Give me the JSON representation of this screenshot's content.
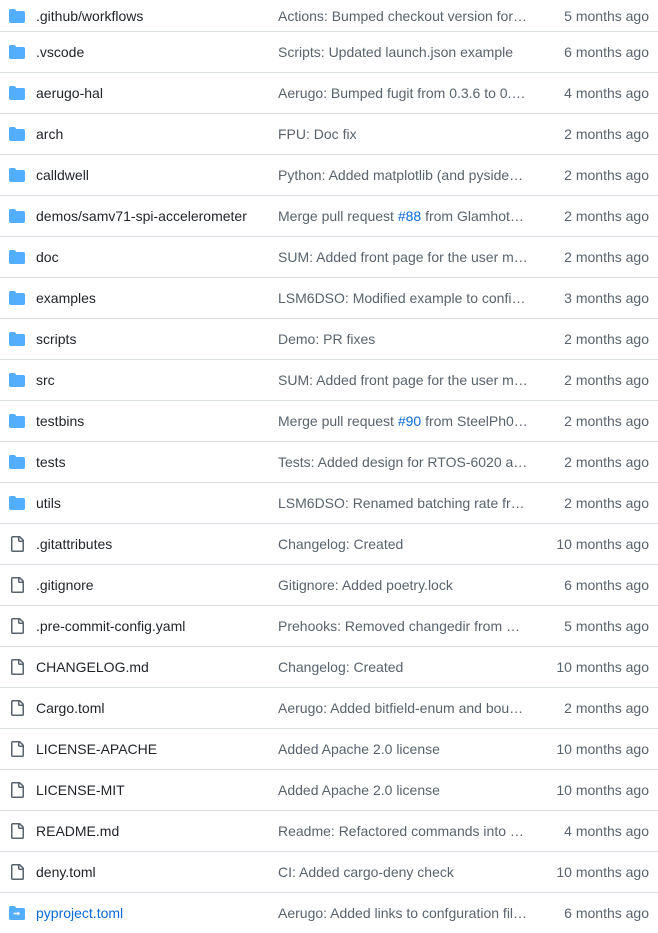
{
  "colors": {
    "folder": "#54aeff",
    "file": "#59636e",
    "link": "#0969da",
    "border": "#d8dee4"
  },
  "rows": [
    {
      "type": "dir",
      "name": ".github/workflows",
      "message": "Actions: Bumped checkout version for …",
      "age": "5 months ago"
    },
    {
      "type": "dir",
      "name": ".vscode",
      "message": "Scripts: Updated launch.json example",
      "age": "6 months ago"
    },
    {
      "type": "dir",
      "name": "aerugo-hal",
      "message": "Aerugo: Bumped fugit from 0.3.6 to 0.…",
      "age": "4 months ago"
    },
    {
      "type": "dir",
      "name": "arch",
      "message": "FPU: Doc fix",
      "age": "2 months ago"
    },
    {
      "type": "dir",
      "name": "calldwell",
      "message": "Python: Added matplotlib (and pyside…",
      "age": "2 months ago"
    },
    {
      "type": "dir",
      "name": "demos/samv71-spi-accelerometer",
      "message_prefix": "Merge pull request ",
      "pr": "#88",
      "message_suffix": " from Glamhot…",
      "age": "2 months ago"
    },
    {
      "type": "dir",
      "name": "doc",
      "message": "SUM: Added front page for the user m…",
      "age": "2 months ago"
    },
    {
      "type": "dir",
      "name": "examples",
      "message": "LSM6DSO: Modified example to config…",
      "age": "3 months ago"
    },
    {
      "type": "dir",
      "name": "scripts",
      "message": "Demo: PR fixes",
      "age": "2 months ago"
    },
    {
      "type": "dir",
      "name": "src",
      "message": "SUM: Added front page for the user m…",
      "age": "2 months ago"
    },
    {
      "type": "dir",
      "name": "testbins",
      "message_prefix": "Merge pull request ",
      "pr": "#90",
      "message_suffix": " from SteelPh0…",
      "age": "2 months ago"
    },
    {
      "type": "dir",
      "name": "tests",
      "message": "Tests: Added design for RTOS-6020 an…",
      "age": "2 months ago"
    },
    {
      "type": "dir",
      "name": "utils",
      "message": "LSM6DSO: Renamed batching rate fre…",
      "age": "2 months ago"
    },
    {
      "type": "file",
      "name": ".gitattributes",
      "message": "Changelog: Created",
      "age": "10 months ago"
    },
    {
      "type": "file",
      "name": ".gitignore",
      "message": "Gitignore: Added poetry.lock",
      "age": "6 months ago"
    },
    {
      "type": "file",
      "name": ".pre-commit-config.yaml",
      "message": "Prehooks: Removed changedir from Ca…",
      "age": "5 months ago"
    },
    {
      "type": "file",
      "name": "CHANGELOG.md",
      "message": "Changelog: Created",
      "age": "10 months ago"
    },
    {
      "type": "file",
      "name": "Cargo.toml",
      "message": "Aerugo: Added bitfield-enum and bou…",
      "age": "2 months ago"
    },
    {
      "type": "file",
      "name": "LICENSE-APACHE",
      "message": "Added Apache 2.0 license",
      "age": "10 months ago"
    },
    {
      "type": "file",
      "name": "LICENSE-MIT",
      "message": "Added Apache 2.0 license",
      "age": "10 months ago"
    },
    {
      "type": "file",
      "name": "README.md",
      "message": "Readme: Refactored commands into c…",
      "age": "4 months ago"
    },
    {
      "type": "file",
      "name": "deny.toml",
      "message": "CI: Added cargo-deny check",
      "age": "10 months ago"
    },
    {
      "type": "symlink",
      "name": "pyproject.toml",
      "message": "Aerugo: Added links to confguration fil…",
      "age": "6 months ago"
    }
  ]
}
